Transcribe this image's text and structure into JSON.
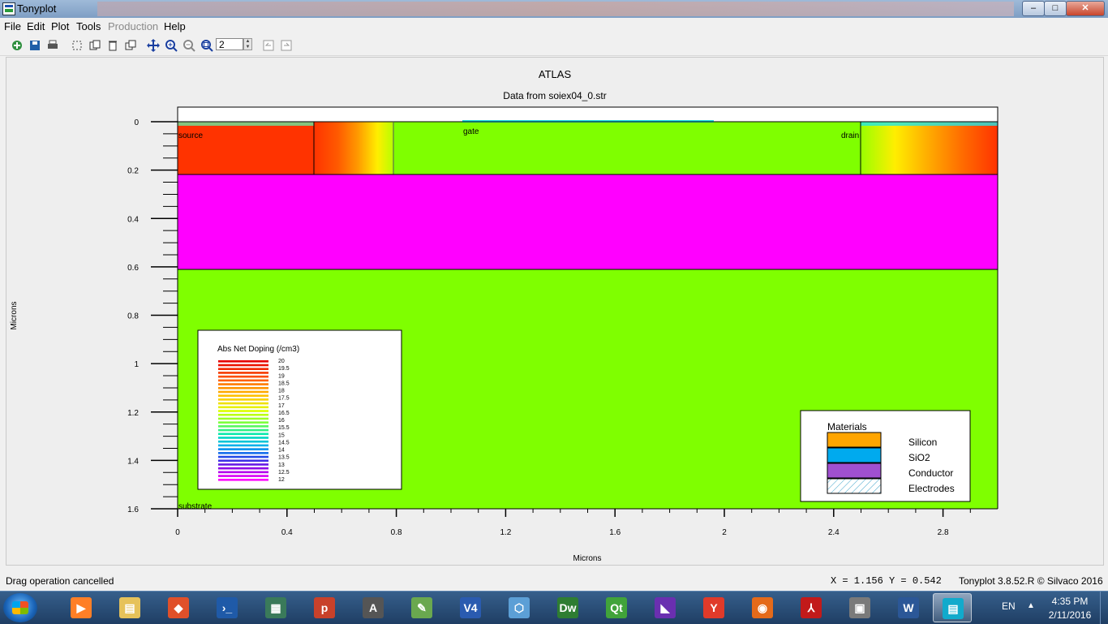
{
  "window": {
    "title": "Tonyplot",
    "min_label": "–",
    "max_label": "□",
    "close_label": "✕"
  },
  "menu": [
    "File",
    "Edit",
    "Plot",
    "Tools",
    "Production",
    "Help"
  ],
  "menu_disabled": [
    4
  ],
  "toolbar": {
    "zoom_value": "2",
    "buttons": [
      "open-icon",
      "save-icon",
      "print-icon",
      "select-icon",
      "copy-icon",
      "delete-icon",
      "arrange-icon",
      "move-icon",
      "zoom-in-icon",
      "zoom-out-icon",
      "zoom-box-icon",
      "undo-icon",
      "redo-icon"
    ]
  },
  "plot": {
    "title": "ATLAS",
    "subtitle": "Data from soiex04_0.str",
    "xlabel": "Microns",
    "ylabel": "Microns",
    "xticks": [
      "0",
      "0.4",
      "0.8",
      "1.2",
      "1.6",
      "2",
      "2.4",
      "2.8"
    ],
    "yticks": [
      "0",
      "0.2",
      "0.4",
      "0.6",
      "0.8",
      "1",
      "1.2",
      "1.4",
      "1.6"
    ],
    "xlim": [
      0,
      3.0
    ],
    "ylim": [
      -0.06,
      1.6
    ],
    "regions": {
      "source_label": "source",
      "gate_label": "gate",
      "drain_label": "drain",
      "substrate_label": "substrate"
    },
    "colors": {
      "silicon_low": "#7fff00",
      "oxide": "#ff00ff",
      "n_plus": "#ff3300",
      "gate": "#22e6e6"
    }
  },
  "doping_legend": {
    "title": "Abs Net Doping (/cm3)",
    "levels": [
      "20",
      "19.5",
      "19",
      "18.5",
      "18",
      "17.5",
      "17",
      "16.5",
      "16",
      "15.5",
      "15",
      "14.5",
      "14",
      "13.5",
      "13",
      "12.5",
      "12"
    ]
  },
  "materials_legend": {
    "title": "Materials",
    "items": [
      {
        "name": "Silicon",
        "color": "#ffa500"
      },
      {
        "name": "SiO2",
        "color": "#00aaee"
      },
      {
        "name": "Conductor",
        "color": "#a050d0"
      },
      {
        "name": "Electrodes",
        "color": "hatch"
      }
    ]
  },
  "status": {
    "message": "Drag operation cancelled",
    "coords": "X = 1.156 Y = 0.542",
    "version": "Tonyplot 3.8.52.R © Silvaco 2016"
  },
  "taskbar": {
    "lang": "EN",
    "time": "4:35 PM",
    "date": "2/11/2016",
    "apps": [
      {
        "name": "media-player-icon",
        "glyph": "▶",
        "color": "#ff7f27"
      },
      {
        "name": "file-explorer-icon",
        "glyph": "▤",
        "color": "#e6c25a"
      },
      {
        "name": "git-icon",
        "glyph": "◆",
        "color": "#e0502a"
      },
      {
        "name": "powershell-icon",
        "glyph": "›_",
        "color": "#1f5aa8"
      },
      {
        "name": "circuit-app-icon",
        "glyph": "▦",
        "color": "#3a7a5a"
      },
      {
        "name": "p-app-icon",
        "glyph": "p",
        "color": "#c8412a"
      },
      {
        "name": "a-app-icon",
        "glyph": "A",
        "color": "#555555"
      },
      {
        "name": "chart-app-icon",
        "glyph": "✎",
        "color": "#6aa84f"
      },
      {
        "name": "v4-app-icon",
        "glyph": "V4",
        "color": "#2a5bb0"
      },
      {
        "name": "cube-app-icon",
        "glyph": "⬡",
        "color": "#5c9fd6"
      },
      {
        "name": "dreamweaver-icon",
        "glyph": "Dw",
        "color": "#2e7d32"
      },
      {
        "name": "qt-creator-icon",
        "glyph": "Qt",
        "color": "#41a33a"
      },
      {
        "name": "visual-studio-icon",
        "glyph": "◣",
        "color": "#6a2fb0"
      },
      {
        "name": "yandex-browser-icon",
        "glyph": "Y",
        "color": "#e03a2a"
      },
      {
        "name": "firefox-icon",
        "glyph": "◉",
        "color": "#e46a1a"
      },
      {
        "name": "acrobat-icon",
        "glyph": "⅄",
        "color": "#c21a1a"
      },
      {
        "name": "deckbuild-icon",
        "glyph": "▣",
        "color": "#7a7a7a"
      },
      {
        "name": "word-icon",
        "glyph": "W",
        "color": "#2b5797"
      },
      {
        "name": "tonyplot-icon",
        "glyph": "▤",
        "color": "#11aacc"
      }
    ],
    "active_index": 18
  }
}
